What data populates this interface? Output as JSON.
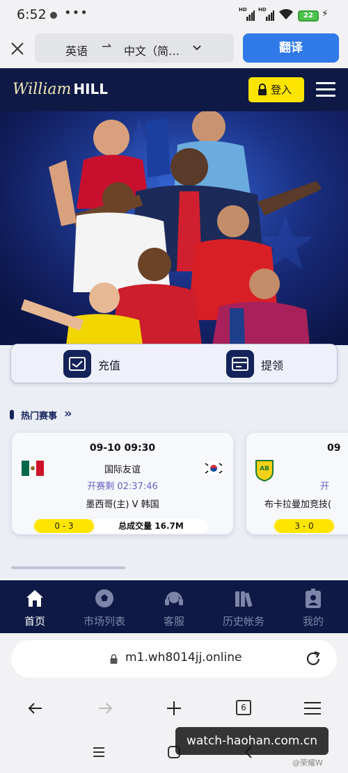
{
  "status_bar": {
    "time": "6:52",
    "more": "•••",
    "hd1": "HD",
    "hd2": "HD",
    "battery": "22",
    "icons": [
      "camera-dot-icon",
      "signal-icon",
      "wifi-icon",
      "battery-icon",
      "charging-icon"
    ]
  },
  "translate_bar": {
    "source_lang": "英语",
    "swap_symbol": "⇀",
    "target_lang": "中文（简…",
    "translate_button": "翻译",
    "icons": [
      "close-icon",
      "chevron-down-icon"
    ]
  },
  "site_header": {
    "logo_script": "William",
    "logo_bold": "HILL",
    "login_button": "登入",
    "icons": [
      "lock-icon",
      "hamburger-menu-icon"
    ]
  },
  "actions": {
    "deposit": "充值",
    "withdraw": "提领",
    "icons": [
      "deposit-card-icon",
      "withdraw-card-icon"
    ]
  },
  "hot_events": {
    "title": "热门赛事",
    "more_symbol": "»",
    "cards": [
      {
        "datetime": "09-10 09:30",
        "league": "国际友谊",
        "countdown": "开赛剩 02:37:46",
        "home_team": "墨西哥(主)",
        "vs": "V",
        "away_team": "韩国",
        "score": "0 - 3",
        "volume": "总成交量 16.7M",
        "home_flag": "mexico-flag-icon",
        "away_flag": "south-korea-flag-icon"
      },
      {
        "datetime": "09",
        "league": "",
        "countdown": "开",
        "home_team": "布卡拉曼加竞技(",
        "score": "3 - 0",
        "home_flag": "atletico-bucaramanga-crest-icon"
      }
    ]
  },
  "tab_bar": {
    "tabs": [
      {
        "label": "首页",
        "icon": "home-icon",
        "active": true
      },
      {
        "label": "市场列表",
        "icon": "soccer-ball-icon",
        "active": false
      },
      {
        "label": "客服",
        "icon": "headset-icon",
        "active": false
      },
      {
        "label": "历史帐务",
        "icon": "books-icon",
        "active": false
      },
      {
        "label": "我的",
        "icon": "profile-badge-icon",
        "active": false
      }
    ]
  },
  "url_bar": {
    "url": "m1.wh8014jj.online",
    "icons": [
      "lock-icon",
      "reload-icon"
    ]
  },
  "browser_nav": {
    "tab_count": "6",
    "icons": [
      "back-arrow-icon",
      "forward-arrow-icon",
      "new-tab-plus-icon",
      "tabs-icon",
      "menu-icon"
    ]
  },
  "android_nav": {
    "icons": [
      "recents-icon",
      "home-square-icon",
      "back-chevron-icon"
    ]
  },
  "watermark": {
    "main": "watch-haohan.com.cn",
    "small": "@荣耀W"
  },
  "colors": {
    "navy": "#0e1a45",
    "yellow": "#fde500",
    "translate_blue": "#2f7ae8"
  }
}
